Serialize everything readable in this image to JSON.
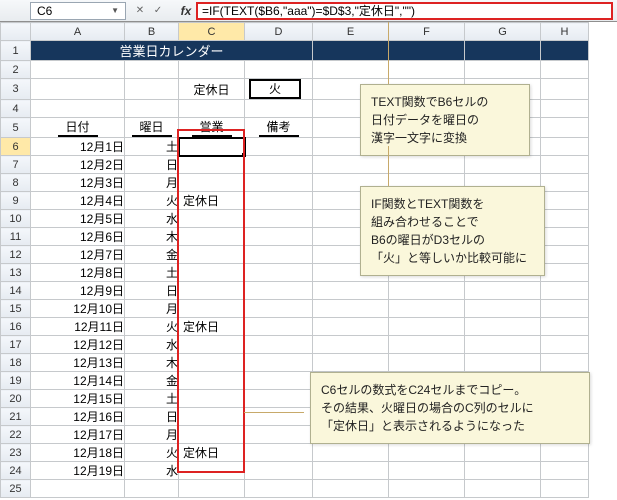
{
  "namebox": "C6",
  "fx": "fx",
  "formula": "=IF(TEXT($B6,\"aaa\")=$D$3,\"定休日\",\"\")",
  "cols": [
    "A",
    "B",
    "C",
    "D",
    "E",
    "F",
    "G",
    "H"
  ],
  "title": "営業日カレンダー",
  "closedLabel": "定休日",
  "closedDay": "火",
  "headers": {
    "date": "日付",
    "dow": "曜日",
    "biz": "営業",
    "note": "備考"
  },
  "rows": [
    {
      "n": 6,
      "date": "12月1日",
      "dow": "土",
      "biz": ""
    },
    {
      "n": 7,
      "date": "12月2日",
      "dow": "日",
      "biz": ""
    },
    {
      "n": 8,
      "date": "12月3日",
      "dow": "月",
      "biz": ""
    },
    {
      "n": 9,
      "date": "12月4日",
      "dow": "火",
      "biz": "定休日"
    },
    {
      "n": 10,
      "date": "12月5日",
      "dow": "水",
      "biz": ""
    },
    {
      "n": 11,
      "date": "12月6日",
      "dow": "木",
      "biz": ""
    },
    {
      "n": 12,
      "date": "12月7日",
      "dow": "金",
      "biz": ""
    },
    {
      "n": 13,
      "date": "12月8日",
      "dow": "土",
      "biz": ""
    },
    {
      "n": 14,
      "date": "12月9日",
      "dow": "日",
      "biz": ""
    },
    {
      "n": 15,
      "date": "12月10日",
      "dow": "月",
      "biz": ""
    },
    {
      "n": 16,
      "date": "12月11日",
      "dow": "火",
      "biz": "定休日"
    },
    {
      "n": 17,
      "date": "12月12日",
      "dow": "水",
      "biz": ""
    },
    {
      "n": 18,
      "date": "12月13日",
      "dow": "木",
      "biz": ""
    },
    {
      "n": 19,
      "date": "12月14日",
      "dow": "金",
      "biz": ""
    },
    {
      "n": 20,
      "date": "12月15日",
      "dow": "土",
      "biz": ""
    },
    {
      "n": 21,
      "date": "12月16日",
      "dow": "日",
      "biz": ""
    },
    {
      "n": 22,
      "date": "12月17日",
      "dow": "月",
      "biz": ""
    },
    {
      "n": 23,
      "date": "12月18日",
      "dow": "火",
      "biz": "定休日"
    },
    {
      "n": 24,
      "date": "12月19日",
      "dow": "水",
      "biz": ""
    }
  ],
  "extraRows": [
    25
  ],
  "annotations": {
    "a1": "TEXT関数でB6セルの\n日付データを曜日の\n漢字一文字に変換",
    "a2": "IF関数とTEXT関数を\n組み合わせることで\nB6の曜日がD3セルの\n「火」と等しいか比較可能に",
    "a3": "C6セルの数式をC24セルまでコピー。\nその結果、火曜日の場合のC列のセルに\n「定休日」と表示されるようになった"
  },
  "colWidths": {
    "A": 94,
    "B": 54,
    "C": 66,
    "D": 68,
    "E": 76,
    "F": 76,
    "G": 76,
    "H": 48
  }
}
